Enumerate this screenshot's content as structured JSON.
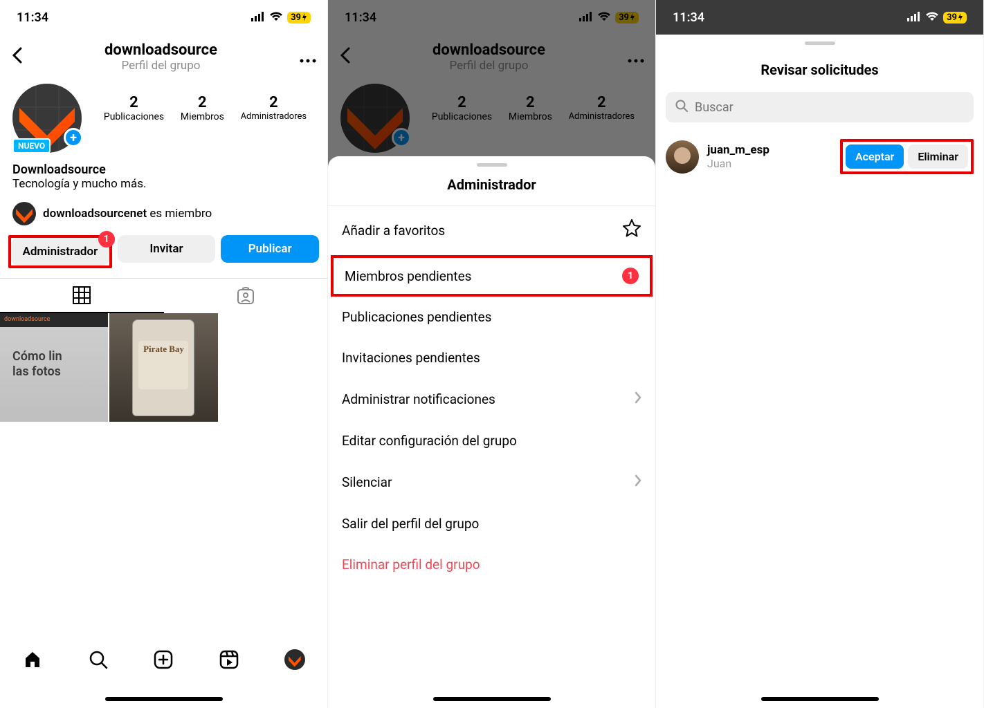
{
  "status": {
    "time": "11:34",
    "battery": "39"
  },
  "screen1": {
    "header": {
      "title": "downloadsource",
      "subtitle": "Perfil del grupo"
    },
    "stats": [
      {
        "num": "2",
        "label": "Publicaciones"
      },
      {
        "num": "2",
        "label": "Miembros"
      },
      {
        "num": "2",
        "label": "Administradores"
      }
    ],
    "nuevo": "NUEVO",
    "bio": {
      "name": "Downloadsource",
      "text": "Tecnología y mucho más."
    },
    "member": {
      "user": "downloadsourcenet",
      "suffix": " es miembro"
    },
    "buttons": {
      "admin": "Administrador",
      "invite": "Invitar",
      "publish": "Publicar",
      "badge": "1"
    },
    "post1": {
      "brand": "downloadsource",
      "line1": "Cómo lin",
      "line2": "las fotos"
    },
    "post2": {
      "label": "Pirate Bay"
    }
  },
  "screen2": {
    "sheet_title": "Administrador",
    "items": {
      "fav": "Añadir a favoritos",
      "pending_members": "Miembros pendientes",
      "pending_badge": "1",
      "pending_posts": "Publicaciones pendientes",
      "pending_invites": "Invitaciones pendientes",
      "notifications": "Administrar notificaciones",
      "edit_group": "Editar configuración del grupo",
      "mute": "Silenciar",
      "leave": "Salir del perfil del grupo",
      "delete": "Eliminar perfil del grupo"
    }
  },
  "screen3": {
    "title": "Revisar solicitudes",
    "search_placeholder": "Buscar",
    "request": {
      "user": "juan_m_esp",
      "name": "Juan",
      "accept": "Aceptar",
      "remove": "Eliminar"
    }
  }
}
